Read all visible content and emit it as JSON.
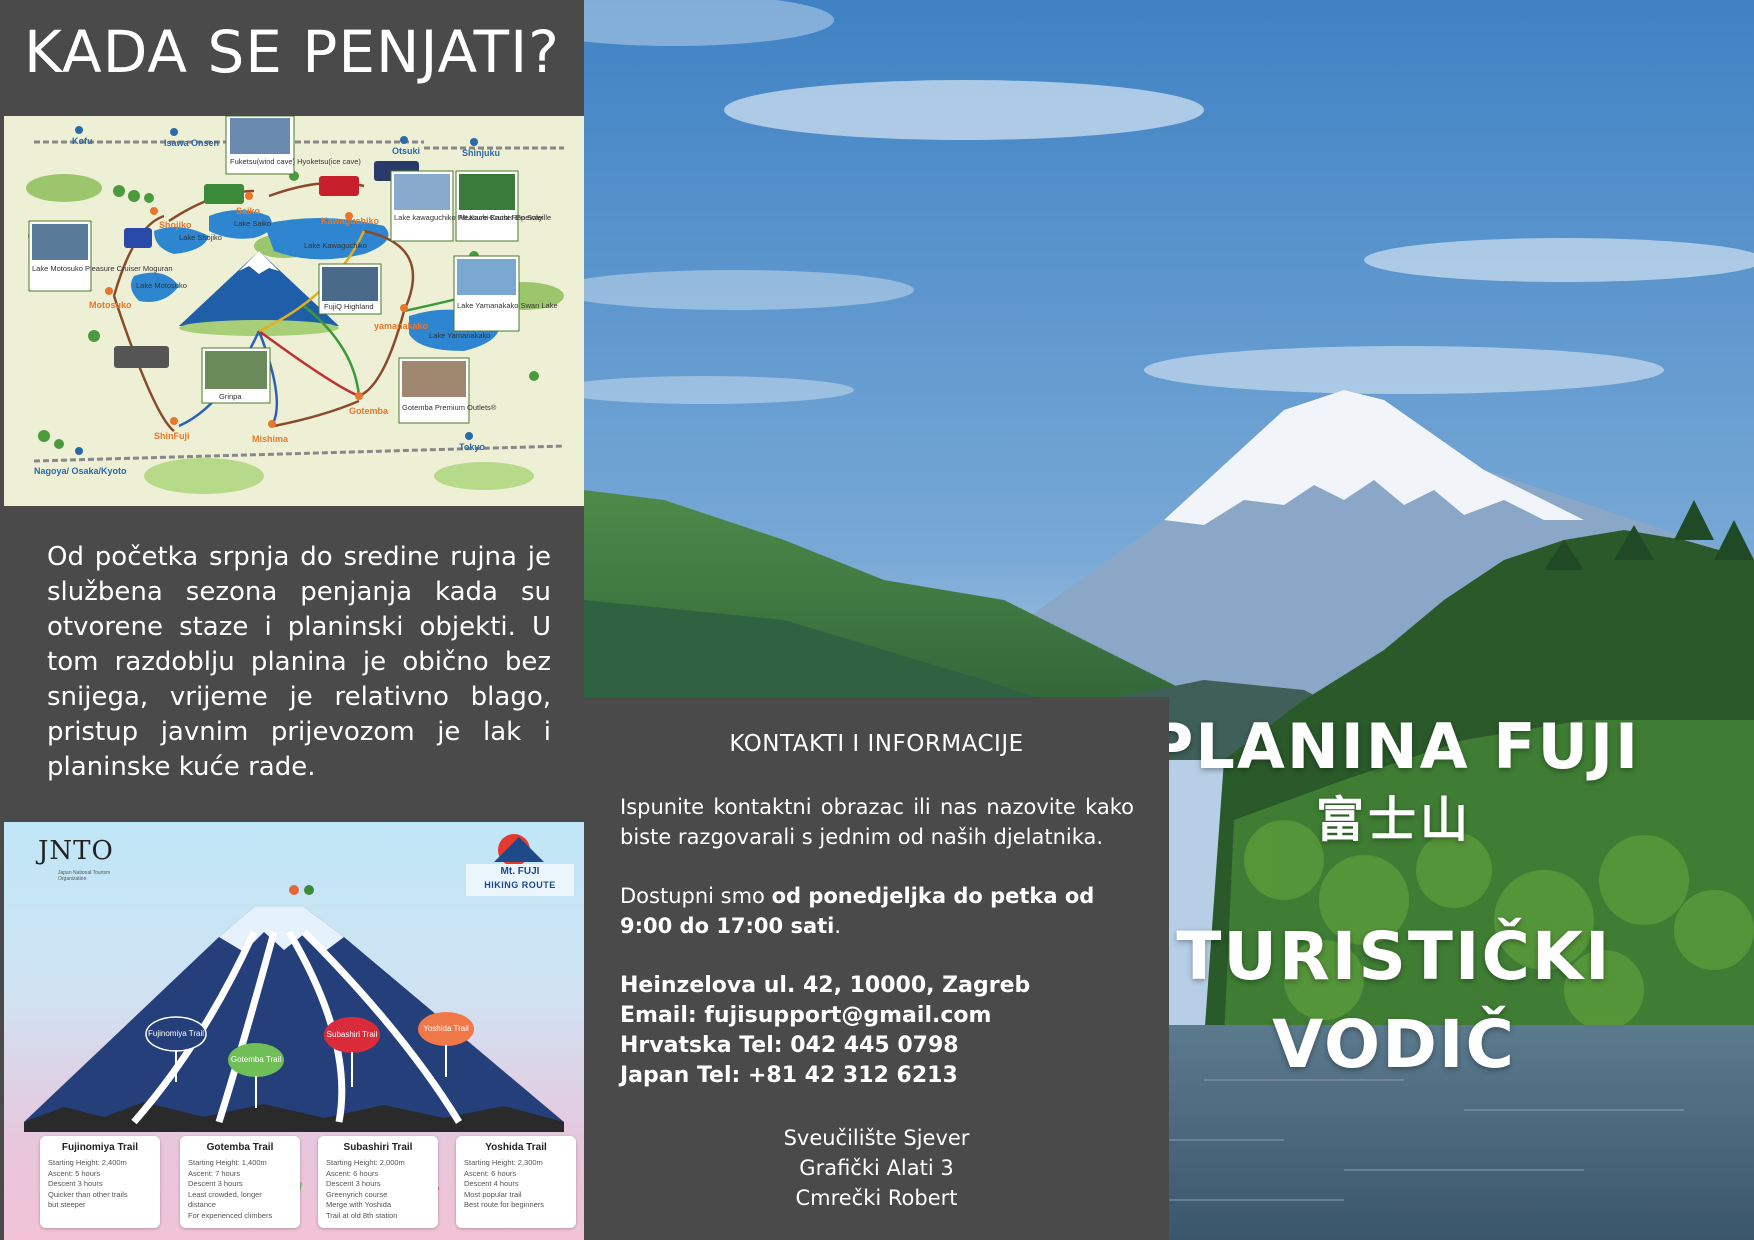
{
  "left": {
    "title": "KADA SE PENJATI?",
    "intro": "Od početka srpnja do sredine rujna je službena sezona penjanja kada su otvorene staze i planinski objekti. U tom razdoblju planina je obično bez snijega, vrijeme je relativno blago, pristup javnim prijevozom je lak i planinske kuće rade."
  },
  "map": {
    "stations": [
      "Kofu",
      "Isawa Onsen",
      "Otsuki",
      "Shinjuku",
      "Nagoya/ Osaka/Kyoto",
      "Tokyo"
    ],
    "towns": [
      "Shojiko",
      "Saiko",
      "Kawaguchiko",
      "Motosuko",
      "yamanakako",
      "Gotemba",
      "ShinFuji",
      "Mishima"
    ],
    "lakes": [
      "Lake Shojiko",
      "Lake Saiko",
      "Lake Kawaguchiko",
      "Lake Motosuko",
      "Lake Yamanakako"
    ],
    "photos": [
      {
        "label": "Fuketsu(wind cave) Hyoketsu(ice cave)"
      },
      {
        "label": "Lake kawaguchiko Pleasure Cruiser En Soleille"
      },
      {
        "label": "Mt.Kachi-Kachi Ropeway"
      },
      {
        "label": "Lake Motosuko Pleasure Cruiser Moguran"
      },
      {
        "label": "FujiQ Highland"
      },
      {
        "label": "Lake Yamanakako Swan Lake"
      },
      {
        "label": "Grinpa"
      },
      {
        "label": "Gotemba Premium Outlets®"
      }
    ]
  },
  "poster": {
    "org": "JNTO",
    "org_sub": "Japan National Tourism Organization",
    "badge_line1": "Mt. FUJI",
    "badge_line2": "HIKING ROUTE",
    "signs": [
      "Fujinomiya Trail",
      "Gotemba Trail",
      "Subashiri Trail",
      "Yoshida Trail"
    ],
    "trails": [
      {
        "name": "Fujinomiya Trail",
        "desc": "Starting Height: 2,400m\nAscent: 5 hours\nDescent 3 hours\nQuicker than other trails\nbut steeper"
      },
      {
        "name": "Gotemba Trail",
        "desc": "Starting Height: 1,400m\nAscent: 7 hours\nDescent 3 hours\nLeast crowded, longer\ndistance\nFor experienced climbers"
      },
      {
        "name": "Subashiri Trail",
        "desc": "Starting Height: 2,000m\nAscent: 6 hours\nDescent 3 hours\nGreenyrich course\nMerge with Yoshida\nTrail at old 8th station"
      },
      {
        "name": "Yoshida Trail",
        "desc": "Starting Height: 2,300m\nAscent: 6 hours\nDescent 4 hours\nMost popular trail\nBest route for beginners"
      }
    ]
  },
  "contact": {
    "heading": "KONTAKTI I INFORMACIJE",
    "text": "Ispunite kontaktni obrazac ili nas nazovite kako biste razgovarali s jednim od naših djelatnika.",
    "availability_prefix": "Dostupni smo ",
    "availability_bold": "od ponedjeljka do petka od 9:00 do 17:00 sati",
    "availability_suffix": ".",
    "address": "Heinzelova ul. 42, 10000, Zagreb",
    "email": "Email: fujisupport@gmail.com",
    "phone_hr": "Hrvatska Tel: 042 445 0798",
    "phone_jp": "Japan Tel: +81 42 312 6213",
    "credit1": "Sveučilište Sjever",
    "credit2": "Grafički Alati 3",
    "credit3": "Cmrečki Robert"
  },
  "hero": {
    "title1": "PLANINA FUJI",
    "kanji": "富士山",
    "title2": "TURISTIČKI",
    "title3": "VODIČ"
  }
}
